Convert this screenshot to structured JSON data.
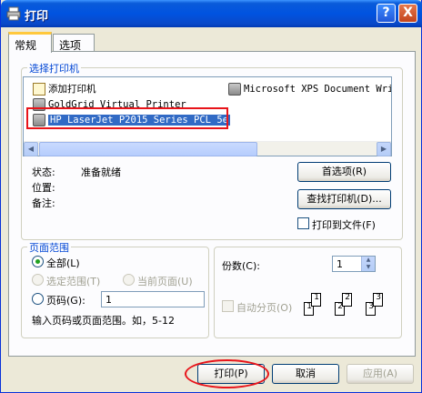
{
  "window": {
    "title": "打印"
  },
  "titlebar": {
    "help_symbol": "?",
    "close_symbol": "X"
  },
  "tabs": [
    {
      "label": "常规"
    },
    {
      "label": "选项"
    }
  ],
  "select_printer": {
    "group_label": "选择打印机",
    "printers": [
      {
        "name": "添加打印机",
        "icon": "add-printer-icon"
      },
      {
        "name": "Microsoft XPS Document Writ",
        "icon": "printer-icon"
      },
      {
        "name": "GoldGrid Virtual Printer",
        "icon": "printer-icon"
      },
      {
        "name": "HP LaserJet P2015 Series PCL 5e",
        "icon": "printer-icon",
        "selected": true
      }
    ],
    "status_label": "状态:",
    "status_value": "准备就绪",
    "location_label": "位置:",
    "location_value": "",
    "comment_label": "备注:",
    "comment_value": "",
    "preferences_button": "首选项(R)",
    "find_printer_button": "查找打印机(D)...",
    "print_to_file_label": "打印到文件(F)"
  },
  "page_range": {
    "group_label": "页面范围",
    "all_label": "全部(L)",
    "selection_label": "选定范围(T)",
    "current_page_label": "当前页面(U)",
    "pages_label": "页码(G):",
    "pages_value": "1",
    "hint": "输入页码或页面范围。如，5-12",
    "selected": "all"
  },
  "copies": {
    "label": "份数(C):",
    "value": "1",
    "collate_label": "自动分页(O)",
    "collate_pages": [
      "1",
      "1",
      "2",
      "2",
      "3",
      "3"
    ]
  },
  "footer": {
    "print_button": "打印(P)",
    "cancel_button": "取消",
    "apply_button": "应用(A)"
  },
  "colors": {
    "title_blue": "#0053e0",
    "highlight": "#316ac5",
    "annotation_red": "#e8141a"
  }
}
